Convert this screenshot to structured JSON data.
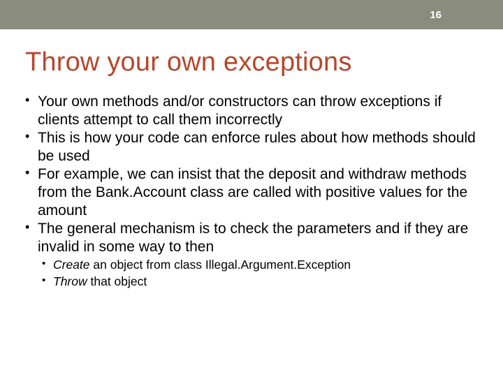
{
  "page_number": "16",
  "title": "Throw your own exceptions",
  "bullets": [
    "Your own methods and/or constructors can throw exceptions if clients attempt to call them incorrectly",
    "This is how your code can enforce rules about how methods should be used",
    "For example, we can insist that the deposit and withdraw methods from the Bank.Account class are called with positive values for the amount",
    "The general mechanism is to check the parameters and if they are invalid in some way to then"
  ],
  "sub_bullets": {
    "0": {
      "em": "Create",
      "rest": " an object from class Illegal.Argument.Exception"
    },
    "1": {
      "em": "Throw",
      "rest": " that object"
    }
  }
}
